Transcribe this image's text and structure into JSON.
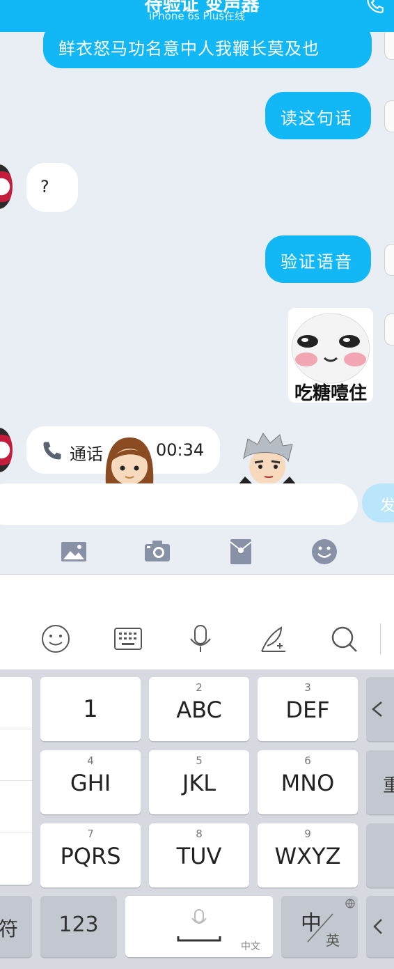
{
  "header": {
    "title": "待验证 变声器",
    "subtitle": "iPhone 6s Plus在线",
    "background": "#12b7f5"
  },
  "messages": [
    {
      "side": "out",
      "text": "鲜衣怒马功名意中人我鞭长莫及也"
    },
    {
      "side": "out",
      "text": "读这句话"
    },
    {
      "side": "in",
      "text": "?"
    },
    {
      "side": "out",
      "text": "验证语音"
    },
    {
      "side": "out",
      "type": "sticker",
      "caption": "吃糖噎住"
    },
    {
      "side": "in",
      "type": "call",
      "label": "通话",
      "duration": "00:34"
    }
  ],
  "input": {
    "placeholder": "",
    "send_label": "发"
  },
  "toolbar": {
    "icons": [
      "image-icon",
      "camera-icon",
      "red-packet-icon",
      "emoji-icon"
    ]
  },
  "keyboard": {
    "toolbar_icons": [
      "emoji-face-icon",
      "keyboard-icon",
      "microphone-icon",
      "handwriting-icon",
      "search-icon"
    ],
    "keys": [
      {
        "sub": "",
        "main": "1"
      },
      {
        "sub": "2",
        "main": "ABC"
      },
      {
        "sub": "3",
        "main": "DEF"
      },
      {
        "sub": "4",
        "main": "GHI"
      },
      {
        "sub": "5",
        "main": "JKL"
      },
      {
        "sub": "6",
        "main": "MNO"
      },
      {
        "sub": "7",
        "main": "PQRS"
      },
      {
        "sub": "8",
        "main": "TUV"
      },
      {
        "sub": "9",
        "main": "WXYZ"
      }
    ],
    "right_partial": "重",
    "bottom": {
      "left_partial": "符",
      "numbers": "123",
      "space_hint": "中文",
      "lang_main": "中",
      "lang_sub": "英"
    }
  }
}
